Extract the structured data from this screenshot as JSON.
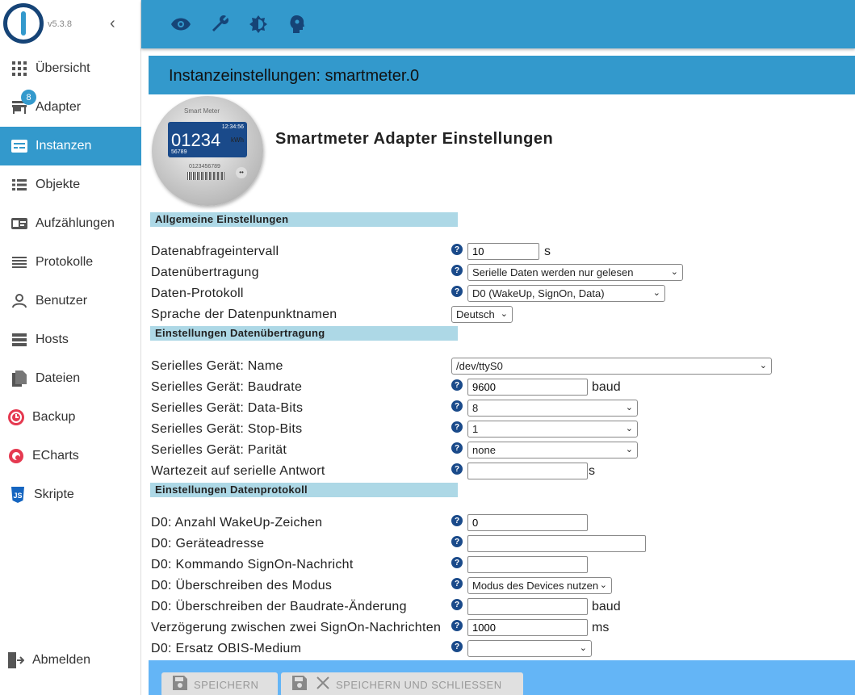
{
  "app": {
    "version": "v5.3.8"
  },
  "sidebar": {
    "items": [
      {
        "label": "Übersicht",
        "icon": "grid-icon"
      },
      {
        "label": "Adapter",
        "icon": "store-icon",
        "badge": "8"
      },
      {
        "label": "Instanzen",
        "icon": "instances-icon",
        "active": true
      },
      {
        "label": "Objekte",
        "icon": "list-icon"
      },
      {
        "label": "Aufzählungen",
        "icon": "enum-icon"
      },
      {
        "label": "Protokolle",
        "icon": "log-icon"
      },
      {
        "label": "Benutzer",
        "icon": "user-icon"
      },
      {
        "label": "Hosts",
        "icon": "hosts-icon"
      },
      {
        "label": "Dateien",
        "icon": "files-icon"
      },
      {
        "label": "Backup",
        "icon": "backup-icon"
      },
      {
        "label": "ECharts",
        "icon": "echarts-icon"
      },
      {
        "label": "Skripte",
        "icon": "js-icon"
      }
    ],
    "logout": "Abmelden"
  },
  "topbar": {
    "icons": [
      "eye-icon",
      "wrench-icon",
      "brightness-icon",
      "expert-head-icon"
    ]
  },
  "instance": {
    "title": "Instanzeinstellungen: smartmeter.0",
    "heading": "Smartmeter Adapter Einstellungen",
    "meter_image": {
      "brand": "Smart Meter",
      "time": "12:34:56",
      "reading": "01234",
      "unit": "kWh",
      "sub": "56789",
      "serial": "0123456789"
    }
  },
  "sections": {
    "general": "Allgemeine Einstellungen",
    "transfer": "Einstellungen Datenübertragung",
    "protocol": "Einstellungen Datenprotokoll"
  },
  "fields": {
    "interval": {
      "label": "Datenabfrageintervall",
      "value": "10",
      "unit": "s"
    },
    "transfer": {
      "label": "Datenübertragung",
      "value": "Serielle Daten werden nur gelesen"
    },
    "protocol": {
      "label": "Daten-Protokoll",
      "value": "D0 (WakeUp, SignOn, Data)"
    },
    "language": {
      "label": "Sprache der Datenpunktnamen",
      "value": "Deutsch"
    },
    "serial_name": {
      "label": "Serielles Gerät: Name",
      "value": "/dev/ttyS0"
    },
    "baudrate": {
      "label": "Serielles Gerät: Baudrate",
      "value": "9600",
      "unit": "baud"
    },
    "databits": {
      "label": "Serielles Gerät: Data-Bits",
      "value": "8"
    },
    "stopbits": {
      "label": "Serielles Gerät: Stop-Bits",
      "value": "1"
    },
    "parity": {
      "label": "Serielles Gerät: Parität",
      "value": "none"
    },
    "response_wait": {
      "label": "Wartezeit auf serielle Antwort",
      "value": "",
      "unit": "s"
    },
    "wakeup_chars": {
      "label": "D0: Anzahl WakeUp-Zeichen",
      "value": "0"
    },
    "device_address": {
      "label": "D0: Geräteadresse",
      "value": ""
    },
    "signon_cmd": {
      "label": "D0: Kommando SignOn-Nachricht",
      "value": ""
    },
    "mode_override": {
      "label": "D0: Überschreiben des Modus",
      "value": "Modus des Devices nutzen"
    },
    "baud_override": {
      "label": "D0: Überschreiben der Baudrate-Änderung",
      "value": "",
      "unit": "baud"
    },
    "signon_delay": {
      "label": "Verzögerung zwischen zwei SignOn-Nachrichten",
      "value": "1000",
      "unit": "ms"
    },
    "obis_medium": {
      "label": "D0: Ersatz OBIS-Medium",
      "value": ""
    }
  },
  "footer": {
    "save": "SPEICHERN",
    "save_close": "SPEICHERN UND SCHLIESSEN"
  }
}
